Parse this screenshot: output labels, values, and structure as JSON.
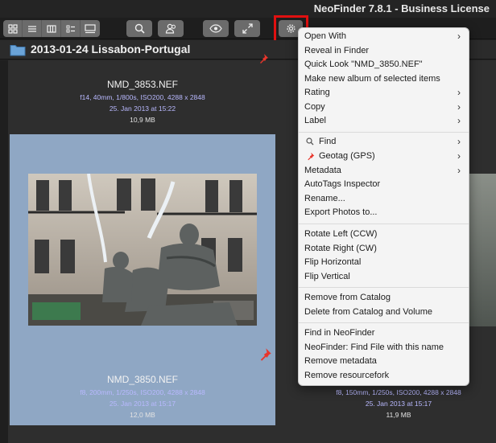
{
  "app": {
    "title": "NeoFinder 7.8.1 - Business License"
  },
  "toolbar": {
    "view_buttons": [
      "grid-view-icon",
      "list-view-icon",
      "column-view-icon",
      "detail-list-icon",
      "preview-view-icon"
    ],
    "buttons": [
      "search-icon",
      "people-icon",
      "eye-icon",
      "expand-icon",
      "gear-icon"
    ]
  },
  "folder": {
    "name": "2013-01-24 Lissabon-Portugal",
    "icon": "folder-icon"
  },
  "cards": [
    {
      "name": "NMD_3853.NEF",
      "exif": "f14, 40mm, 1/800s, ISO200, 4288 x 2848",
      "date": "25. Jan 2013 at 15:22",
      "size": "10,9 MB"
    },
    {
      "name": "NMD_3850.NEF",
      "exif": "f8, 200mm, 1/250s, ISO200, 4288 x 2848",
      "date": "25. Jan 2013 at 15:17",
      "size": "12,0 MB",
      "selected": true
    },
    {
      "name": "",
      "exif": "f8, 150mm, 1/250s, ISO200, 4288 x 2848",
      "date": "25. Jan 2013 at 15:17",
      "size": "11,9 MB"
    }
  ],
  "menu": {
    "items": [
      {
        "label": "Open With",
        "submenu": true
      },
      {
        "label": "Reveal in Finder"
      },
      {
        "label": "Quick Look \"NMD_3850.NEF\""
      },
      {
        "label": "Make new album of selected items"
      },
      {
        "label": "Rating",
        "submenu": true
      },
      {
        "label": "Copy",
        "submenu": true
      },
      {
        "label": "Label",
        "submenu": true
      },
      {
        "label": "Find",
        "submenu": true,
        "icon": "search-icon"
      },
      {
        "label": "Geotag (GPS)",
        "submenu": true,
        "icon": "pin-icon"
      },
      {
        "label": "Metadata",
        "submenu": true
      },
      {
        "label": "AutoTags Inspector"
      },
      {
        "label": "Rename..."
      },
      {
        "label": "Export Photos to..."
      },
      {
        "label": "Rotate Left (CCW)"
      },
      {
        "label": "Rotate Right (CW)"
      },
      {
        "label": "Flip Horizontal"
      },
      {
        "label": "Flip Vertical"
      },
      {
        "label": "Remove from Catalog"
      },
      {
        "label": "Delete from Catalog and Volume"
      },
      {
        "label": "Find in NeoFinder"
      },
      {
        "label": "NeoFinder: Find File with this name"
      },
      {
        "label": "Remove metadata"
      },
      {
        "label": "Remove resourcefork"
      }
    ]
  },
  "colors": {
    "accent_highlight": "#e01010",
    "pin": "#e8352b",
    "selection": "#8fa7c4",
    "meta_text": "#b9b9ff"
  }
}
